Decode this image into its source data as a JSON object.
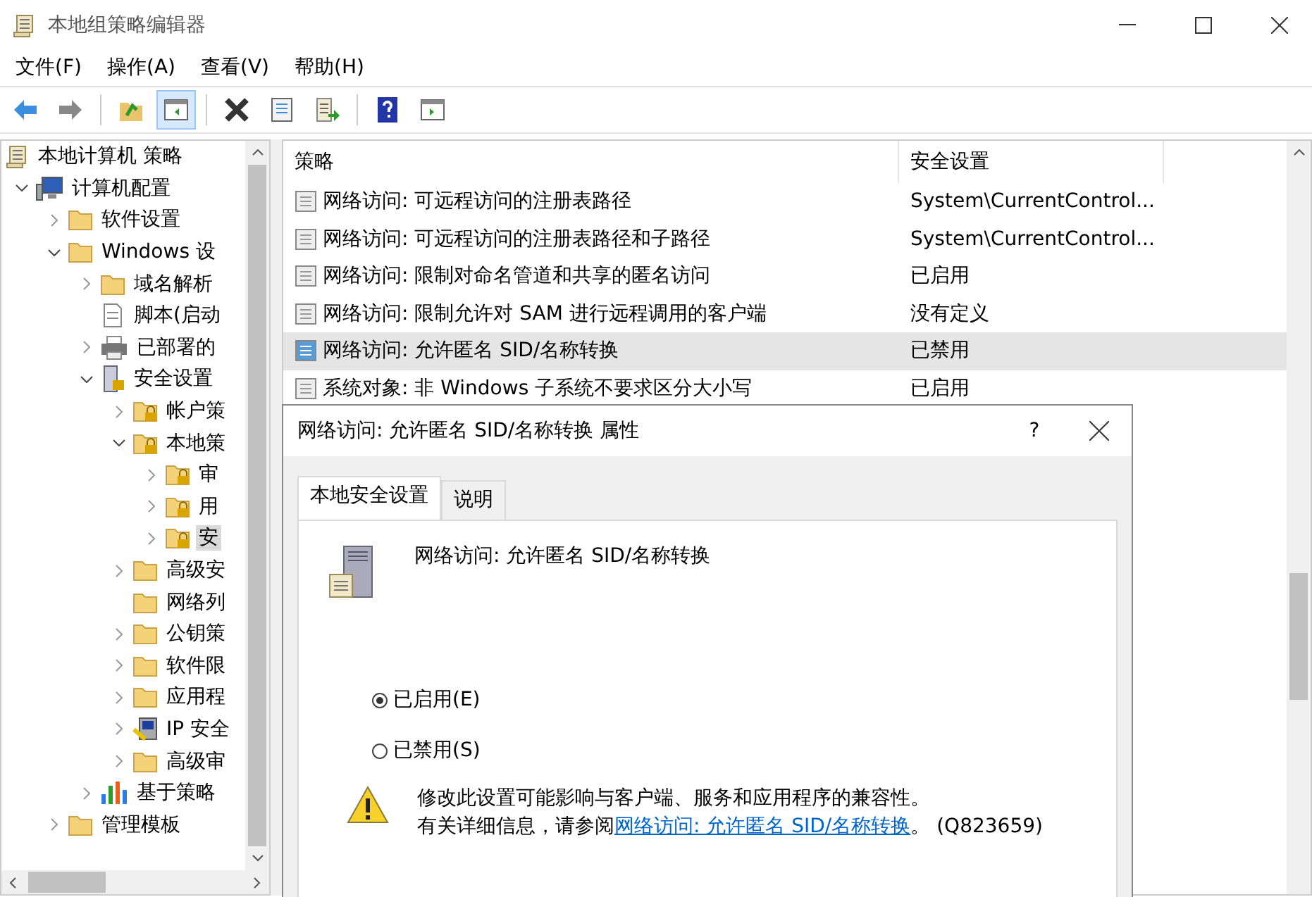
{
  "window": {
    "title": "本地组策略编辑器"
  },
  "menu": [
    "文件(F)",
    "操作(A)",
    "查看(V)",
    "帮助(H)"
  ],
  "toolbar": [
    {
      "kind": "back",
      "selected": false
    },
    {
      "kind": "forward",
      "selected": false
    },
    {
      "kind": "up",
      "selected": false
    },
    {
      "kind": "panel",
      "selected": true
    },
    {
      "kind": "delete",
      "selected": false
    },
    {
      "kind": "properties",
      "selected": false
    },
    {
      "kind": "export",
      "selected": false
    },
    {
      "kind": "help",
      "selected": false
    },
    {
      "kind": "view",
      "selected": false
    }
  ],
  "tree": [
    {
      "label": "本地计算机 策略",
      "kind": "scroll",
      "selected": false,
      "children": [
        {
          "label": "计算机配置",
          "kind": "computer",
          "expanded": true,
          "selected": false,
          "children": [
            {
              "label": "软件设置",
              "kind": "folder",
              "expanded": false,
              "selected": false
            },
            {
              "label": "Windows 设",
              "kind": "folder",
              "expanded": true,
              "selected": false,
              "children": [
                {
                  "label": "域名解析",
                  "kind": "folder",
                  "expanded": false,
                  "selected": false
                },
                {
                  "label": "脚本(启动",
                  "kind": "script",
                  "selected": false
                },
                {
                  "label": "已部署的",
                  "kind": "printer",
                  "expanded": false,
                  "selected": false
                },
                {
                  "label": "安全设置",
                  "kind": "server",
                  "expanded": true,
                  "selected": false,
                  "children": [
                    {
                      "label": "帐户策",
                      "kind": "lockfolder",
                      "expanded": false,
                      "selected": false
                    },
                    {
                      "label": "本地策",
                      "kind": "lockfolder",
                      "expanded": true,
                      "selected": false,
                      "children": [
                        {
                          "label": "审",
                          "kind": "lockfolder",
                          "expanded": false,
                          "selected": false
                        },
                        {
                          "label": "用",
                          "kind": "lockfolder",
                          "expanded": false,
                          "selected": false
                        },
                        {
                          "label": "安",
                          "kind": "lockfolder",
                          "expanded": false,
                          "selected": true
                        }
                      ]
                    },
                    {
                      "label": "高级安",
                      "kind": "folder",
                      "expanded": false,
                      "selected": false
                    },
                    {
                      "label": "网络列",
                      "kind": "folder",
                      "selected": false
                    },
                    {
                      "label": "公钥策",
                      "kind": "folder",
                      "expanded": false,
                      "selected": false
                    },
                    {
                      "label": "软件限",
                      "kind": "folder",
                      "expanded": false,
                      "selected": false
                    },
                    {
                      "label": "应用程",
                      "kind": "folder",
                      "expanded": false,
                      "selected": false
                    },
                    {
                      "label": "IP 安全",
                      "kind": "ipsec",
                      "expanded": false,
                      "selected": false
                    },
                    {
                      "label": "高级审",
                      "kind": "folder",
                      "expanded": false,
                      "selected": false
                    }
                  ]
                },
                {
                  "label": "基于策略",
                  "kind": "chart",
                  "expanded": false,
                  "selected": false
                }
              ]
            },
            {
              "label": "管理模板",
              "kind": "folder",
              "expanded": false,
              "selected": false
            }
          ]
        }
      ]
    }
  ],
  "table": {
    "columns": [
      "策略",
      "安全设置"
    ],
    "rows": [
      {
        "policy": "网络访问: 可远程访问的注册表路径",
        "setting": "System\\CurrentControl...",
        "selected": false
      },
      {
        "policy": "网络访问: 可远程访问的注册表路径和子路径",
        "setting": "System\\CurrentControl...",
        "selected": false
      },
      {
        "policy": "网络访问: 限制对命名管道和共享的匿名访问",
        "setting": "已启用",
        "selected": false
      },
      {
        "policy": "网络访问: 限制允许对 SAM 进行远程调用的客户端",
        "setting": "没有定义",
        "selected": false
      },
      {
        "policy": "网络访问: 允许匿名 SID/名称转换",
        "setting": "已禁用",
        "selected": true
      },
      {
        "policy": "系统对象: 非 Windows 子系统不要求区分大小写",
        "setting": "已启用",
        "selected": false
      }
    ]
  },
  "dialog": {
    "title": "网络访问: 允许匿名 SID/名称转换 属性",
    "help": "?",
    "tabs": [
      {
        "label": "本地安全设置",
        "selected": true
      },
      {
        "label": "说明",
        "selected": false
      }
    ],
    "policy_name": "网络访问: 允许匿名 SID/名称转换",
    "options": [
      {
        "label": "已启用(E)",
        "selected": true
      },
      {
        "label": "已禁用(S)",
        "selected": false
      }
    ],
    "warning": "修改此设置可能影响与客户端、服务和应用程序的兼容性。",
    "more_info": {
      "before": "有关详细信息，请参阅",
      "link": "网络访问: 允许匿名 SID/名称转换",
      "after": "。 (Q823659)"
    }
  }
}
